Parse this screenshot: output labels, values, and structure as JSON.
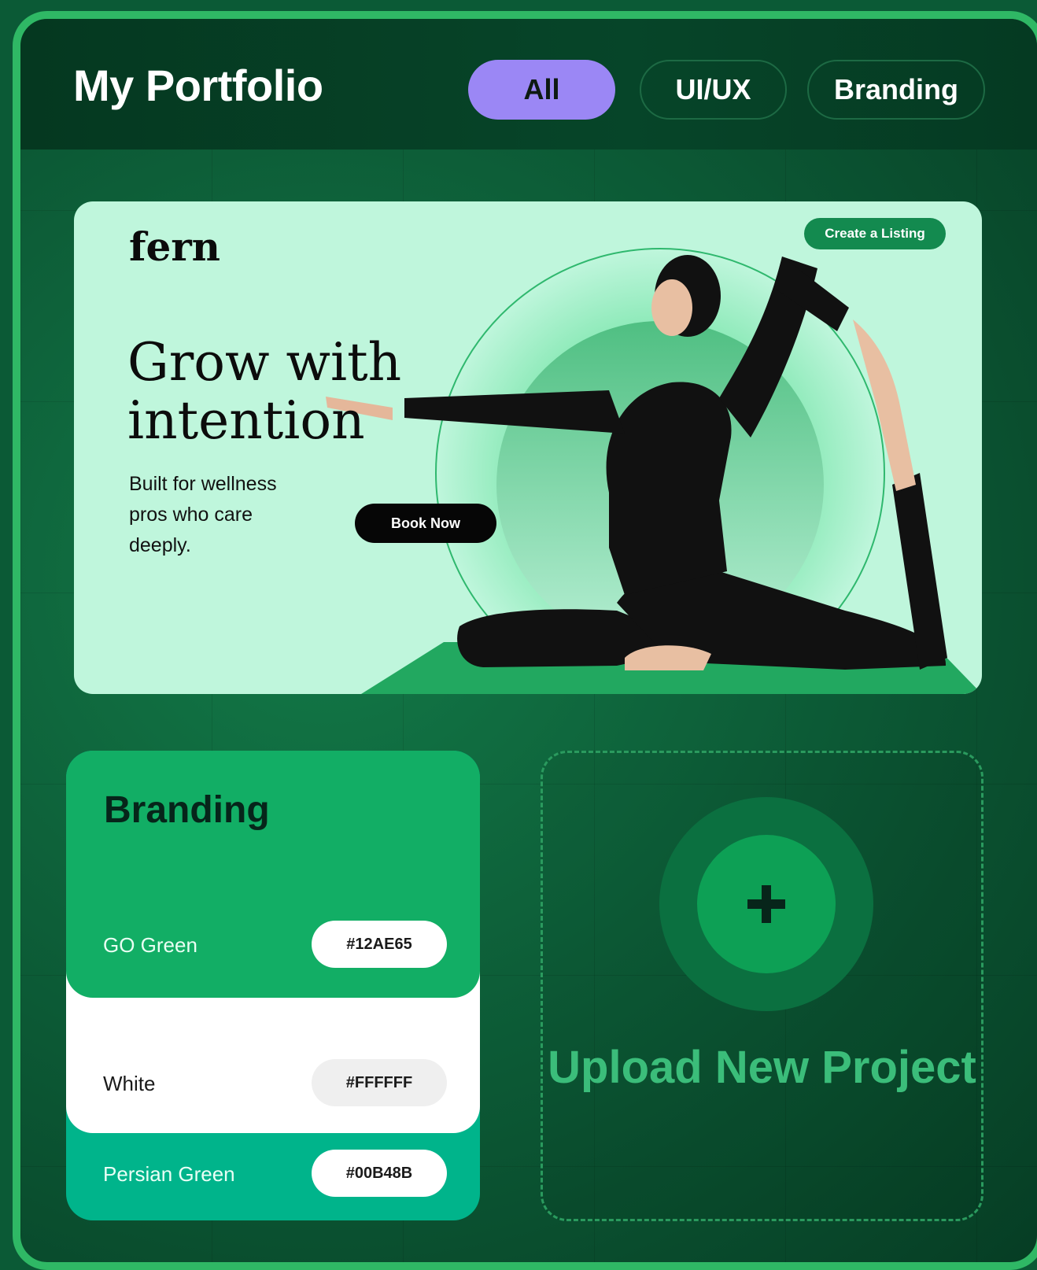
{
  "header": {
    "title": "My Portfolio",
    "filters": [
      {
        "label": "All",
        "active": true
      },
      {
        "label": "UI/UX",
        "active": false
      },
      {
        "label": "Branding",
        "active": false
      }
    ]
  },
  "hero": {
    "logo": "fern",
    "top_button": "Create a Listing",
    "heading": "Grow with intention",
    "subtitle": "Built for wellness pros who care deeply.",
    "cta": "Book Now"
  },
  "branding": {
    "title": "Branding",
    "swatches": [
      {
        "name": "GO Green",
        "hex": "#12AE65"
      },
      {
        "name": "White",
        "hex": "#FFFFFF"
      },
      {
        "name": "Persian Green",
        "hex": "#00B48B"
      }
    ]
  },
  "upload": {
    "label": "Upload New Project",
    "icon": "plus-icon"
  },
  "colors": {
    "accent": "#9B87F5",
    "frame_border": "#2FB865",
    "go_green": "#12AE65",
    "persian_green": "#00B48B"
  }
}
